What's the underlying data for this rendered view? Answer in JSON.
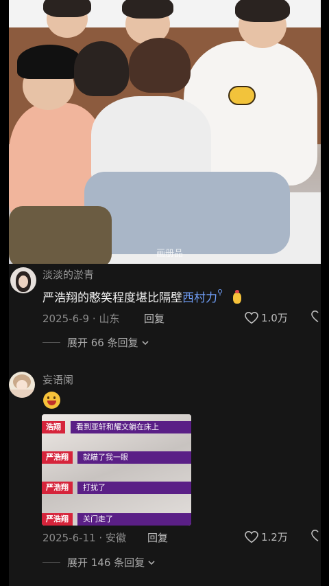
{
  "video": {
    "watermark": "画册品"
  },
  "comments": [
    {
      "username": "淡淡的淤青",
      "text": "严浩翔的憨笑程度堪比隔壁",
      "link": "西村力",
      "date": "2025-6-9",
      "location": "山东",
      "reply_label": "回复",
      "likes": "1.0万",
      "expand_label": "展开 66 条回复"
    },
    {
      "username": "妄语阑",
      "date": "2025-6-11",
      "location": "安徽",
      "reply_label": "回复",
      "likes": "1.2万",
      "expand_label": "展开 146 条回复",
      "meme_rows": [
        {
          "tag": "浩翔",
          "caption": "看到亚轩和耀文躺在床上"
        },
        {
          "tag": "严浩翔",
          "caption": "就瞄了我一眼"
        },
        {
          "tag": "严浩翔",
          "caption": "打扰了"
        },
        {
          "tag": "严浩翔",
          "caption": "关门走了"
        }
      ]
    }
  ],
  "icons": {
    "heart": "heart-icon",
    "search_hint": "search-icon",
    "chevron": "chevron-down-icon"
  },
  "colors": {
    "link": "#6f9df5",
    "meme_tag": "#d6243b",
    "meme_bar": "#5a1f86"
  }
}
